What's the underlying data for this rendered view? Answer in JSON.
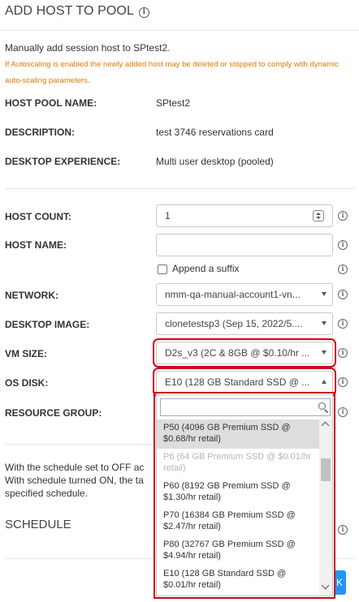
{
  "header": {
    "title": "ADD HOST TO POOL"
  },
  "intro": {
    "description": "Manually add session host to SPtest2.",
    "warning": "If Autoscaling is enabled the newly added host may be deleted or stopped to comply with dynamic auto-scaling parameters."
  },
  "pool_info": {
    "host_pool_name_label": "HOST POOL NAME:",
    "host_pool_name_value": "SPtest2",
    "description_label": "DESCRIPTION:",
    "description_value": "test 3746 reservations card",
    "desktop_experience_label": "DESKTOP EXPERIENCE:",
    "desktop_experience_value": "Multi user desktop (pooled)"
  },
  "form": {
    "host_count_label": "HOST COUNT:",
    "host_count_value": "1",
    "host_name_label": "HOST NAME:",
    "host_name_value": "",
    "append_suffix_label": "Append a suffix",
    "network_label": "NETWORK:",
    "network_value": "nmm-qa-manual-account1-vn...",
    "desktop_image_label": "DESKTOP IMAGE:",
    "desktop_image_value": "clonetestsp3 (Sep 15, 2022/5....",
    "vm_size_label": "VM SIZE:",
    "vm_size_value": "D2s_v3 (2C & 8GB @ $0.10/hr ...",
    "os_disk_label": "OS DISK:",
    "os_disk_value": "E10 (128 GB Standard SSD @ ...",
    "resource_group_label": "RESOURCE GROUP:"
  },
  "os_disk_dropdown": {
    "search_value": "",
    "options": [
      {
        "label": "P50 (4096 GB Premium SSD @ $0.68/hr retail)",
        "state": "hovered"
      },
      {
        "label": "P6 (64 GB Premium SSD @ $0.01/hr retail)",
        "state": "disabled"
      },
      {
        "label": "P60 (8192 GB Premium SSD @ $1.30/hr retail)",
        "state": "normal"
      },
      {
        "label": "P70 (16384 GB Premium SSD @ $2.47/hr retail)",
        "state": "normal"
      },
      {
        "label": "P80 (32767 GB Premium SSD @ $4.94/hr retail)",
        "state": "normal"
      },
      {
        "label": "E10 (128 GB Standard SSD @ $0.01/hr retail)",
        "state": "normal"
      }
    ]
  },
  "schedule": {
    "line1": "With the schedule set to OFF ac",
    "line2": "With schedule turned ON, the ta",
    "line3": "specified schedule.",
    "title": "SCHEDULE"
  },
  "footer": {
    "button_label": "K"
  },
  "colors": {
    "warning": "#e07b00",
    "highlight": "#d0021b",
    "primary": "#2196f3"
  }
}
